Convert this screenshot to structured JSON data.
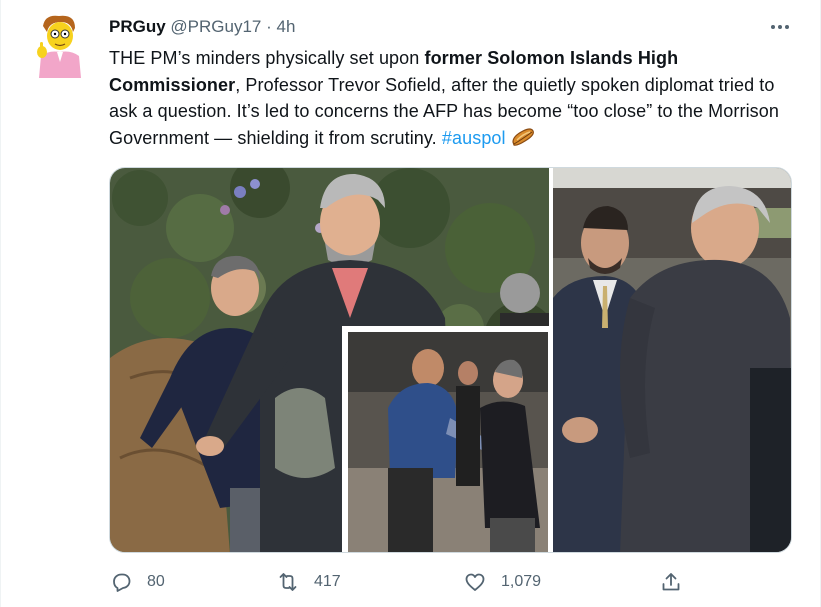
{
  "tweet": {
    "author_name": "PRGuy",
    "author_handle": "@PRGuy17",
    "separator": "·",
    "timestamp": "4h",
    "text_parts": {
      "p1": "THE PM’s minders physically set upon ",
      "p2_bold": "former Solomon Islands High Commissioner",
      "p3": ", Professor Trevor Sofield, after the quietly spoken diplomat tried to ask a question. It’s led to concerns the AFP has become “too close” to the Morrison Government — shielding it from scrutiny. ",
      "hashtag": "#auspol"
    }
  },
  "actions": {
    "reply_count": "80",
    "retweet_count": "417",
    "like_count": "1,079"
  },
  "icons": {
    "more": "more-dots-icon",
    "reply": "reply-icon",
    "retweet": "retweet-icon",
    "like": "heart-icon",
    "share": "share-icon",
    "hashtag_emoji": "sausage-roll-emoji-icon"
  },
  "colors": {
    "text": "#0f1419",
    "secondary": "#536471",
    "link": "#1d9bf0",
    "border": "#cfd9de"
  }
}
